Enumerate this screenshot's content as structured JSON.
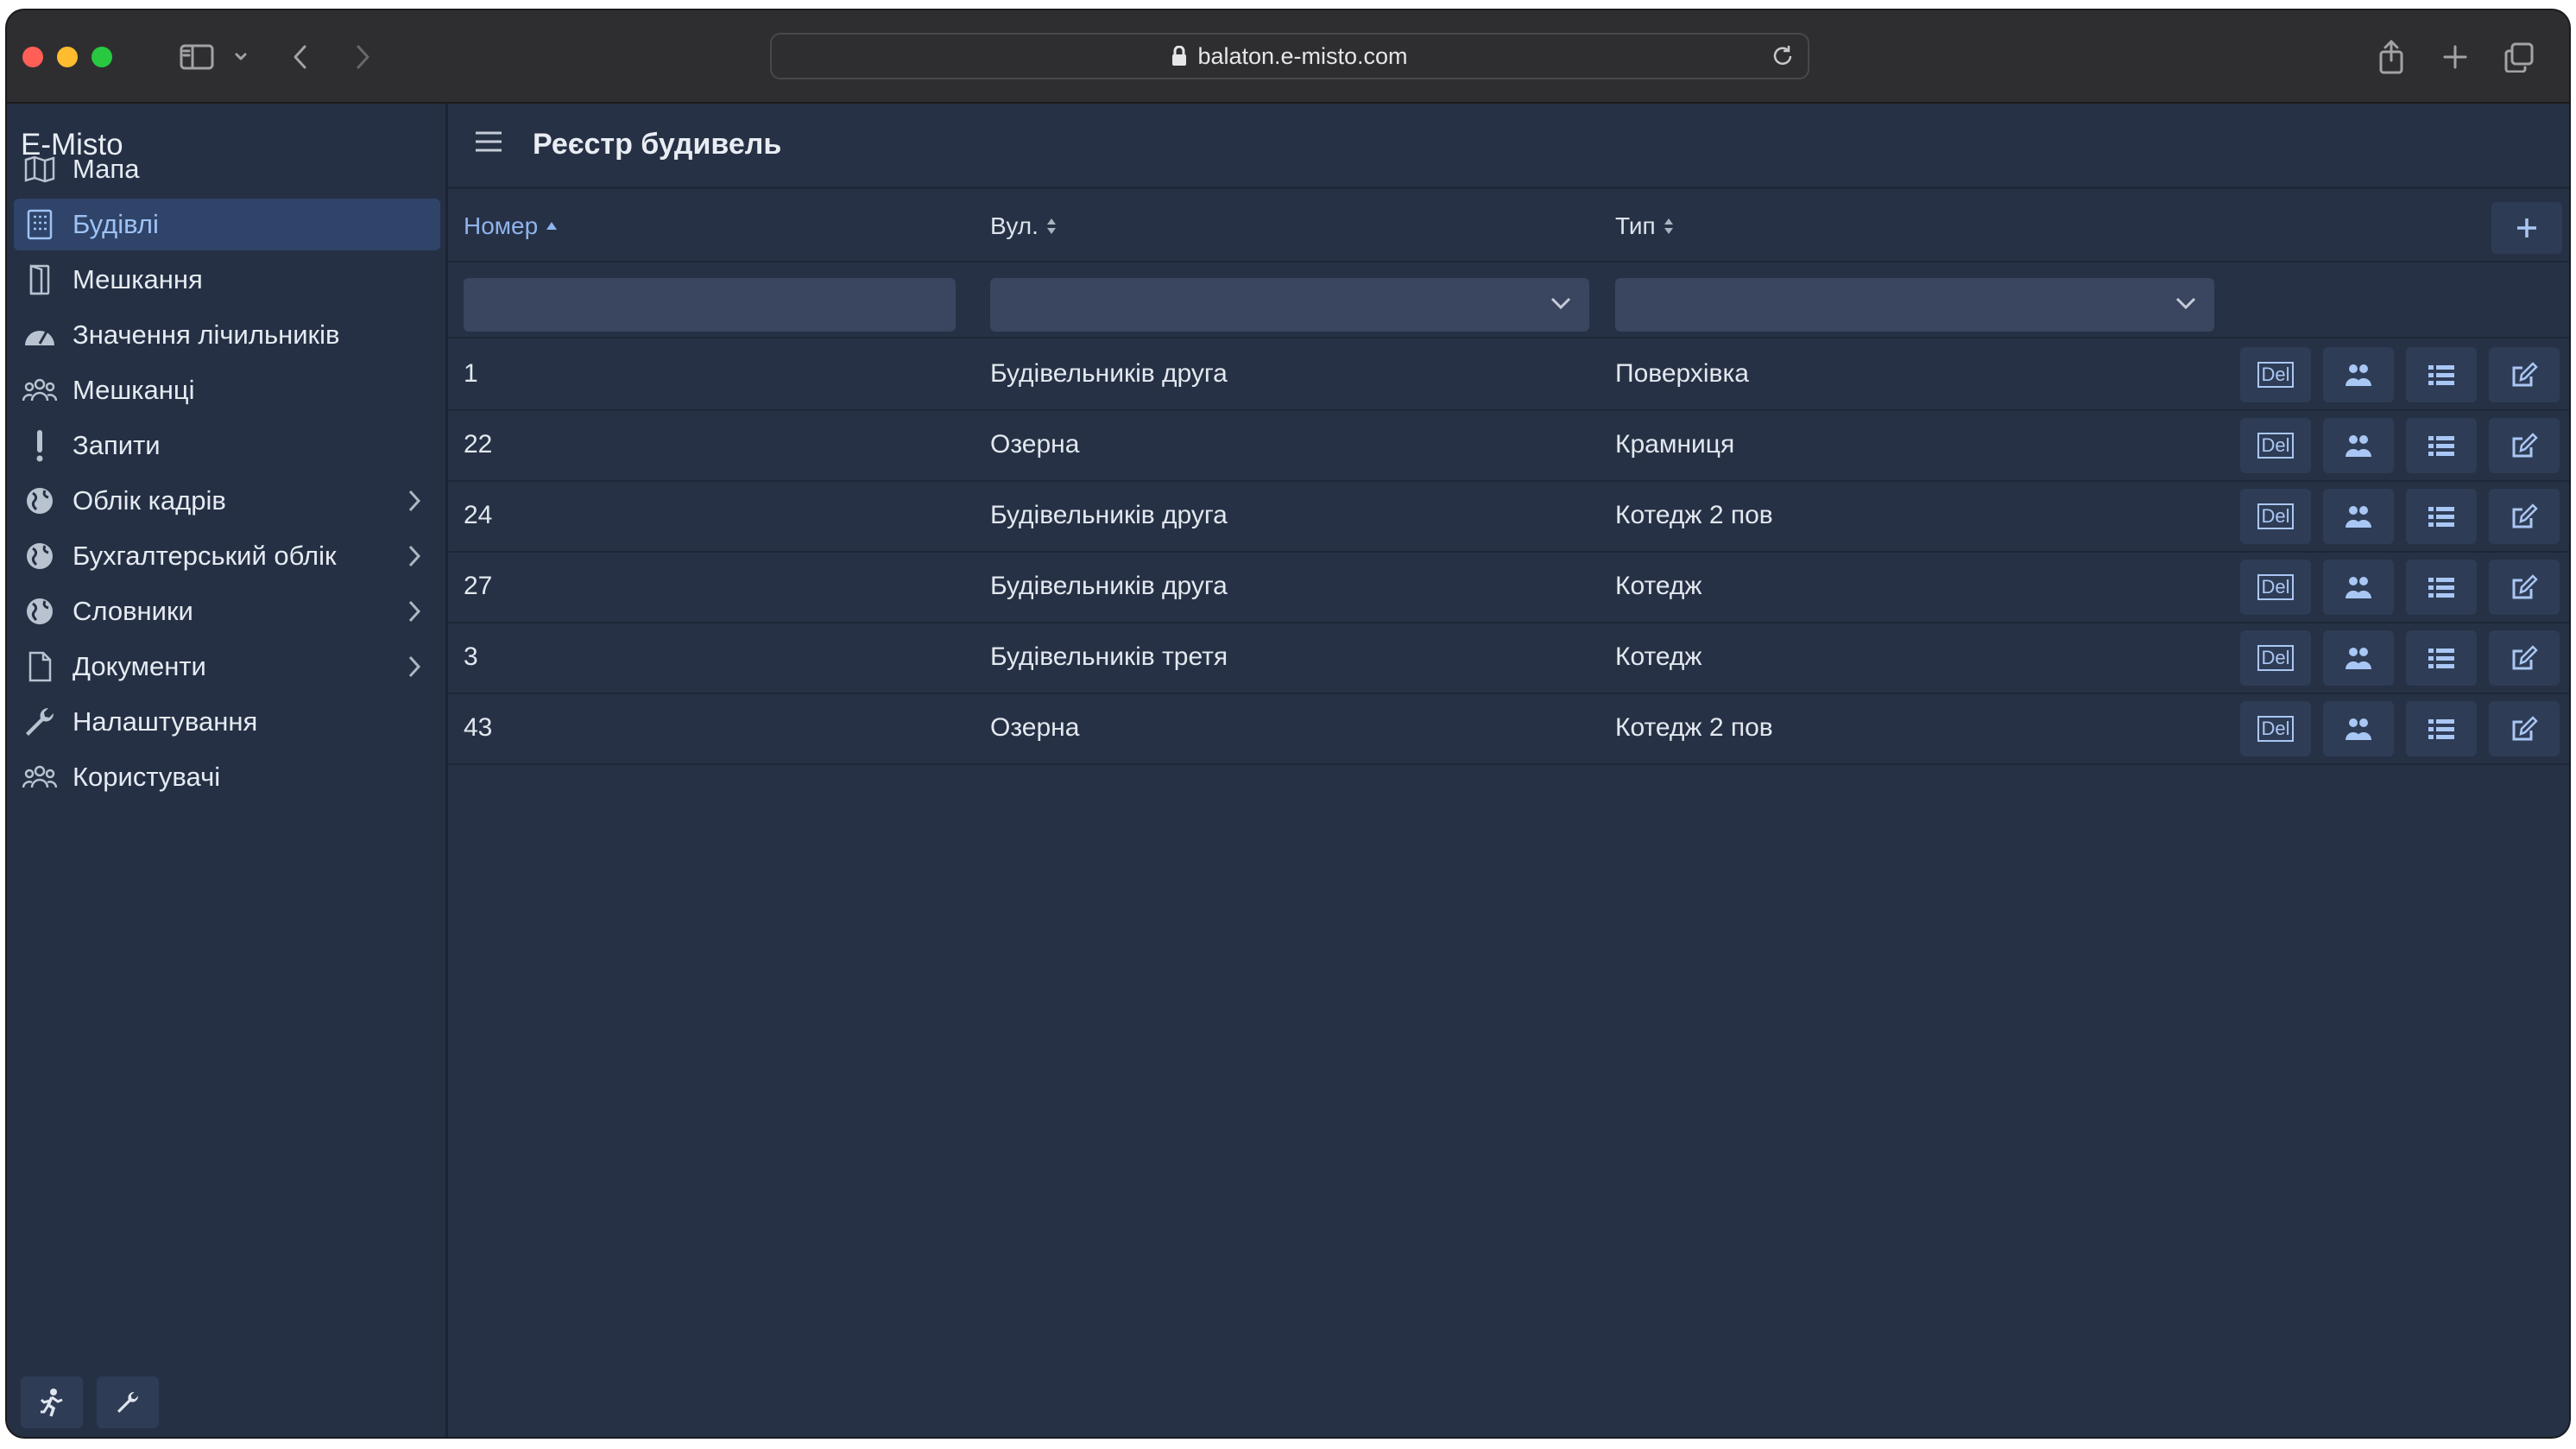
{
  "browser": {
    "url": "balaton.e-misto.com",
    "traffic_lights": [
      "#ff5f57",
      "#febc2e",
      "#28c840"
    ]
  },
  "sidebar": {
    "brand": "E-Misto",
    "items": [
      {
        "label": "Мапа",
        "icon": "map-icon"
      },
      {
        "label": "Будівлі",
        "icon": "building-icon",
        "active": true
      },
      {
        "label": "Мешкання",
        "icon": "door-icon"
      },
      {
        "label": "Значення лічильників",
        "icon": "gauge-icon"
      },
      {
        "label": "Мешканці",
        "icon": "people-icon"
      },
      {
        "label": "Запити",
        "icon": "exclamation-icon"
      },
      {
        "label": "Облік кадрів",
        "icon": "globe-icon",
        "expandable": true
      },
      {
        "label": "Бухгалтерський облік",
        "icon": "globe-icon",
        "expandable": true
      },
      {
        "label": "Словники",
        "icon": "globe-icon",
        "expandable": true
      },
      {
        "label": "Документи",
        "icon": "document-icon",
        "expandable": true
      },
      {
        "label": "Налаштування",
        "icon": "wrench-icon"
      },
      {
        "label": "Користувачі",
        "icon": "people-icon"
      }
    ]
  },
  "page": {
    "title": "Реєстр будивель"
  },
  "table": {
    "columns": [
      "Номер",
      "Вул.",
      "Тип"
    ],
    "sorted_column": "Номер",
    "action_labels": {
      "delete": "Del"
    },
    "rows": [
      {
        "number": "1",
        "street": "Будівельників друга",
        "type": "Поверхівка"
      },
      {
        "number": "22",
        "street": "Озерна",
        "type": "Крамниця"
      },
      {
        "number": "24",
        "street": "Будівельників друга",
        "type": "Котедж 2 пов"
      },
      {
        "number": "27",
        "street": "Будівельників друга",
        "type": "Котедж"
      },
      {
        "number": "3",
        "street": "Будівельників третя",
        "type": "Котедж"
      },
      {
        "number": "43",
        "street": "Озерна",
        "type": "Котедж 2 пов"
      }
    ]
  },
  "colors": {
    "background": "#263145",
    "accent": "#8fb4ee",
    "active_nav": "#2f4468"
  }
}
